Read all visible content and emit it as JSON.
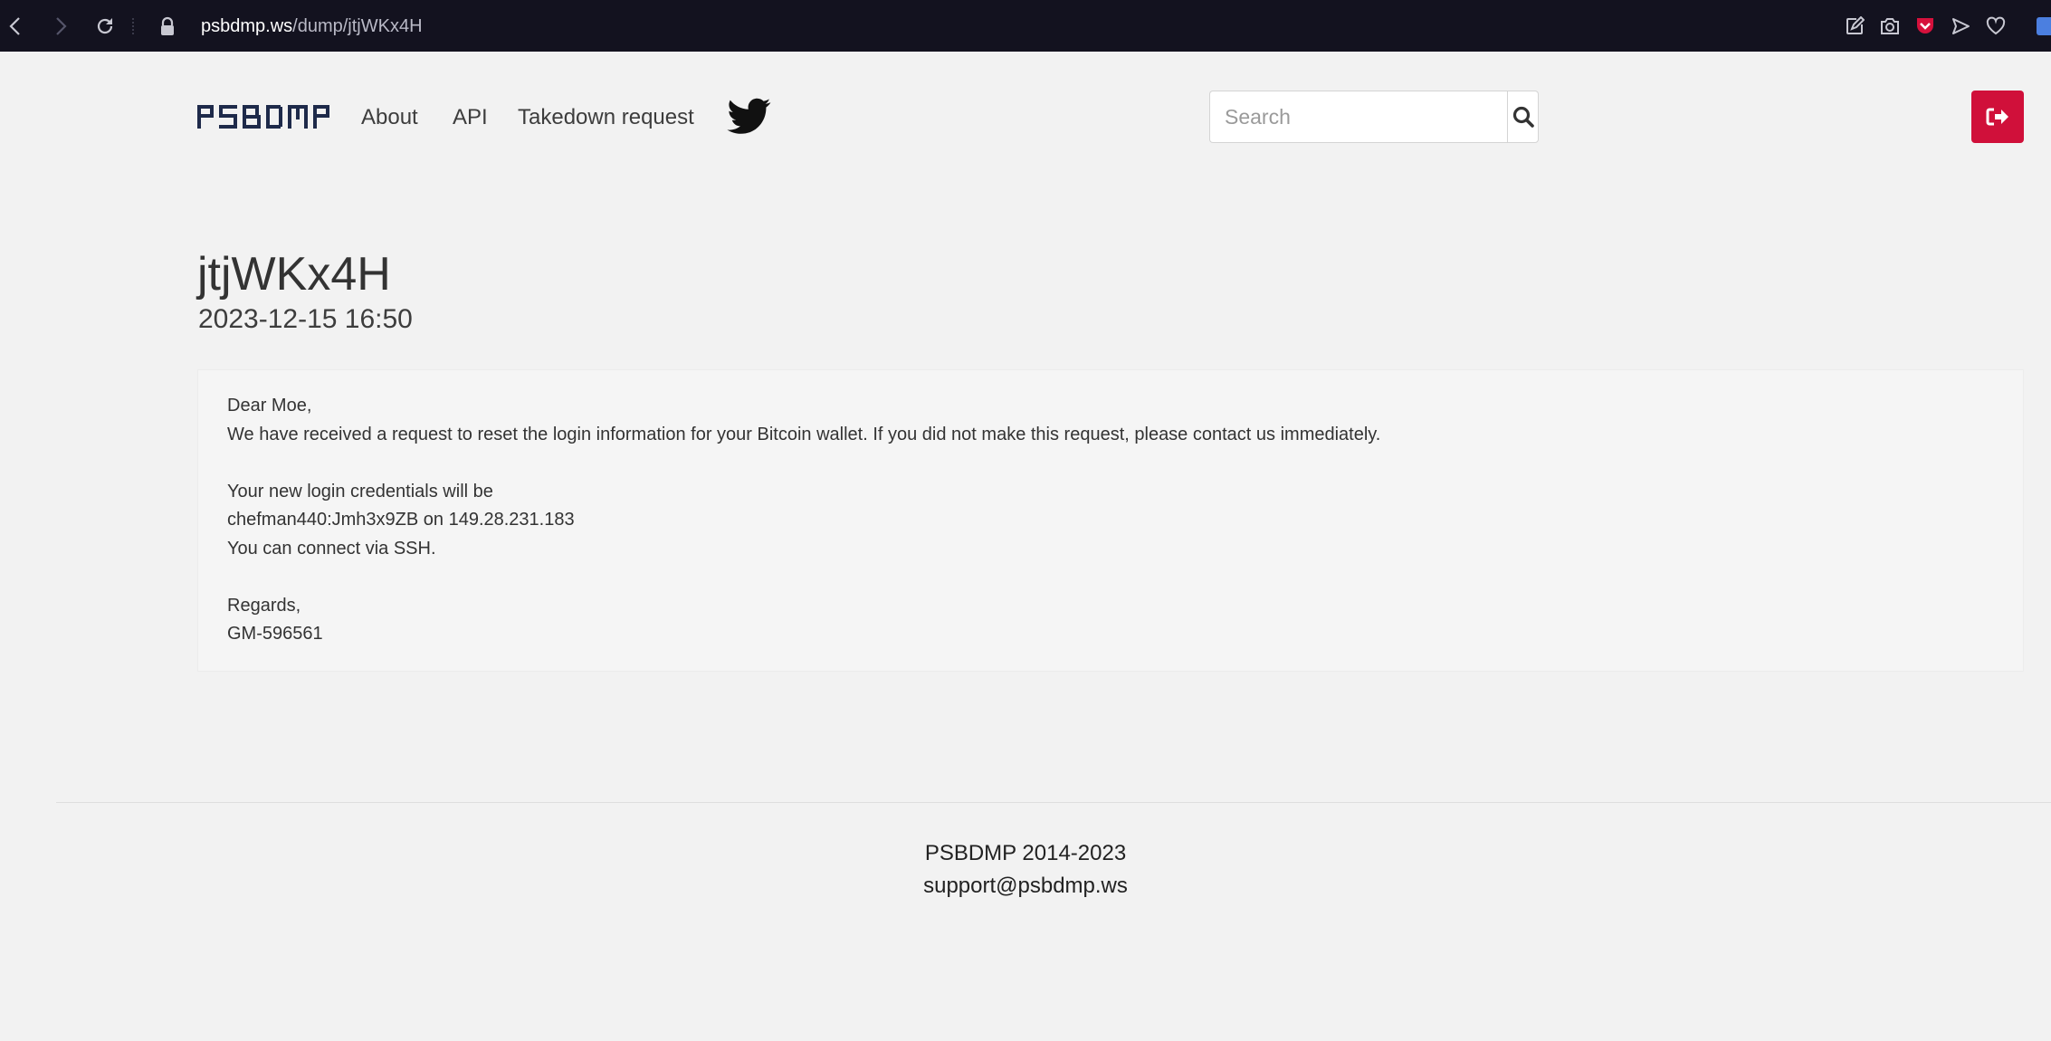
{
  "browser": {
    "url_host": "psbdmp.ws",
    "url_path": "/dump/jtjWKx4H"
  },
  "header": {
    "logo_text": "PSBDMP",
    "nav": {
      "about": "About",
      "api": "API",
      "takedown": "Takedown request"
    },
    "search_placeholder": "Search"
  },
  "dump": {
    "id": "jtjWKx4H",
    "date": "2023-12-15 16:50",
    "lines": [
      "Dear Moe,",
      "We have received a request to reset the login information for your Bitcoin wallet. If you did not make this request, please contact us immediately.",
      "",
      "Your new login credentials will be",
      "chefman440:Jmh3x9ZB on 149.28.231.183",
      "You can connect via SSH.",
      "",
      "Regards,",
      "GM-596561"
    ]
  },
  "footer": {
    "copyright": "PSBDMP 2014-2023",
    "email": "support@psbdmp.ws"
  },
  "colors": {
    "page_background": "#f2f2f2",
    "browser_bar": "#13121f",
    "logo": "#1e2a4a",
    "twitter": "#111111",
    "logout_button": "#d0103a",
    "extension_badge": "#d6113c",
    "translate_badge": "#4b7fe0"
  },
  "icons": {
    "back": "chevron-left-icon",
    "forward": "chevron-right-icon",
    "reload": "reload-icon",
    "lock": "lock-icon",
    "search": "search-icon",
    "logout": "sign-out-icon",
    "twitter": "twitter-icon"
  }
}
